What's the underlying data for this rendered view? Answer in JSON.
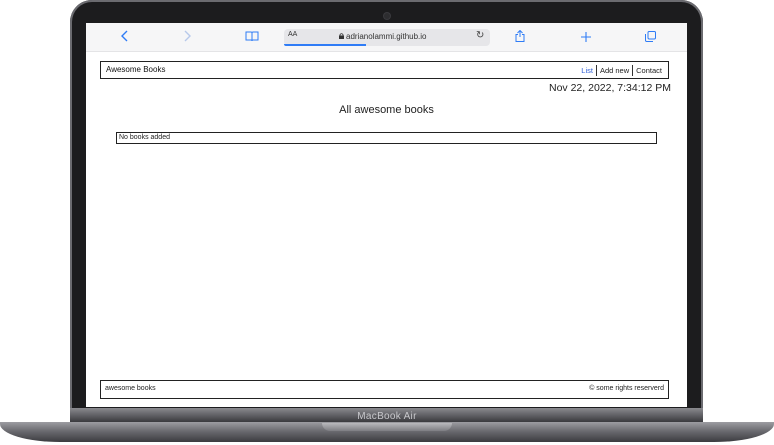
{
  "device": {
    "brand_label": "MacBook Air"
  },
  "browser": {
    "text_size_label": "AA",
    "url": "adrianolammi.github.io",
    "icons": [
      "back-icon",
      "forward-icon",
      "bookmarks-icon",
      "lock-icon",
      "reload-icon",
      "share-icon",
      "new-tab-icon",
      "tabs-icon"
    ],
    "accent_color": "#2f7cf6",
    "load_progress_percent": 40
  },
  "app": {
    "brand": "Awesome Books",
    "nav": [
      {
        "label": "List",
        "active": true
      },
      {
        "label": "Add new",
        "active": false
      },
      {
        "label": "Contact",
        "active": false
      }
    ],
    "datetime": "Nov 22, 2022, 7:34:12 PM",
    "heading": "All awesome books",
    "empty_message": "No books added",
    "footer": {
      "left": "awesome books",
      "right": "© some rights reserverd"
    }
  }
}
